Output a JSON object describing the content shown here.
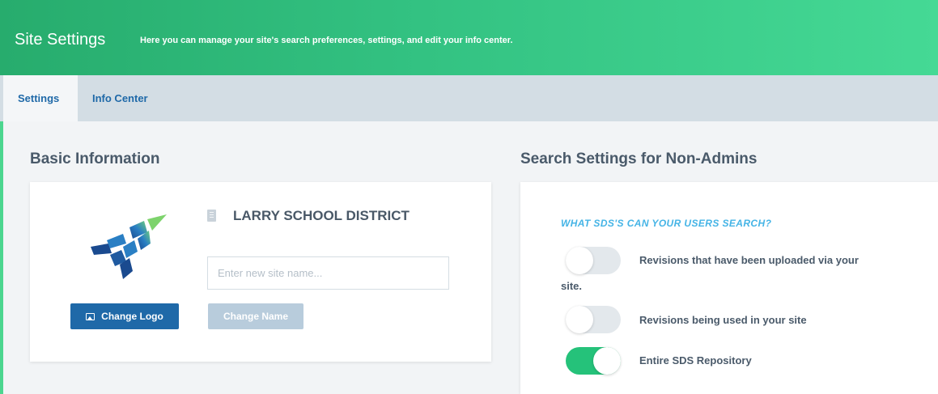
{
  "header": {
    "title": "Site Settings",
    "subtitle": "Here you can manage your site's search preferences, settings, and edit your info center."
  },
  "tabs": [
    {
      "label": "Settings",
      "active": true
    },
    {
      "label": "Info Center",
      "active": false
    }
  ],
  "basic": {
    "title": "Basic Information",
    "district_name": "LARRY SCHOOL DISTRICT",
    "site_name_placeholder": "Enter new site name...",
    "site_name_value": "",
    "change_logo_label": "Change Logo",
    "change_name_label": "Change Name"
  },
  "search": {
    "title": "Search Settings for Non-Admins",
    "question": "WHAT SDS'S CAN YOUR USERS SEARCH?",
    "options": [
      {
        "label_line1": "Revisions that have been uploaded via your",
        "label_line2": "site.",
        "enabled": false
      },
      {
        "label": "Revisions being used in your site",
        "enabled": false
      },
      {
        "label": "Entire SDS Repository",
        "enabled": true
      }
    ]
  },
  "colors": {
    "header_gradient_start": "#27ac6d",
    "header_gradient_end": "#45d995",
    "primary_blue": "#1f69a8",
    "toggle_on": "#25c27a",
    "question_blue": "#45b4e6"
  }
}
